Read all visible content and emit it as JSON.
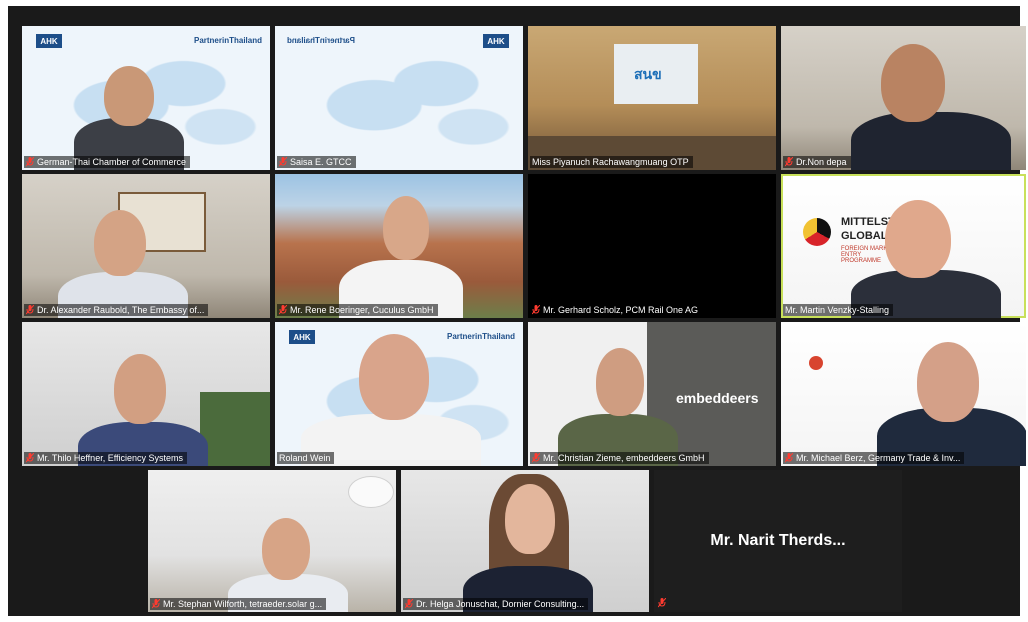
{
  "participants": [
    {
      "name": "German-Thai Chamber of Commerce",
      "muted": true
    },
    {
      "name": "Saisa E. GTCC",
      "muted": true
    },
    {
      "name": "Miss Piyanuch  Rachawangmuang OTP",
      "muted": false
    },
    {
      "name": "Dr.Non  depa",
      "muted": true
    },
    {
      "name": "Dr. Alexander Raubold, The Embassy of...",
      "muted": true
    },
    {
      "name": "Mr. Rene Boeringer, Cuculus GmbH",
      "muted": true
    },
    {
      "name": "Mr. Gerhard Scholz, PCM Rail One AG",
      "muted": true
    },
    {
      "name": "Mr. Martin Venzky-Stalling",
      "muted": false
    },
    {
      "name": "Mr. Thilo Heffner, Efficiency Systems",
      "muted": true
    },
    {
      "name": "Roland Wein",
      "muted": false
    },
    {
      "name": "Mr. Christian Zieme, embeddeers GmbH",
      "muted": true
    },
    {
      "name": "Mr. Michael Berz, Germany Trade & Inv...",
      "muted": true
    },
    {
      "name": "Mr. Stephan Wilforth, tetraeder.solar g...",
      "muted": true
    },
    {
      "name": "Dr. Helga Jonuschat, Dornier Consulting...",
      "muted": true
    },
    {
      "name": "Mr. Narit Therds...",
      "muted": true
    }
  ],
  "overlays": {
    "partner_logo": "PartnerinThailand",
    "partner_logo_mirrored": "PartnerinThailand",
    "ahk": "AHK",
    "mittelstand_line1": "MITTELSTAND",
    "mittelstand_line2": "GLOBAL",
    "mittelstand_sub": "FOREIGN MARKET ENTRY PROGRAMME",
    "embeddeers": "embeddeers",
    "otp_logo": "สนข"
  },
  "colors": {
    "active_speaker_border": "#c8e05a",
    "muted_icon": "#ff3b30"
  }
}
